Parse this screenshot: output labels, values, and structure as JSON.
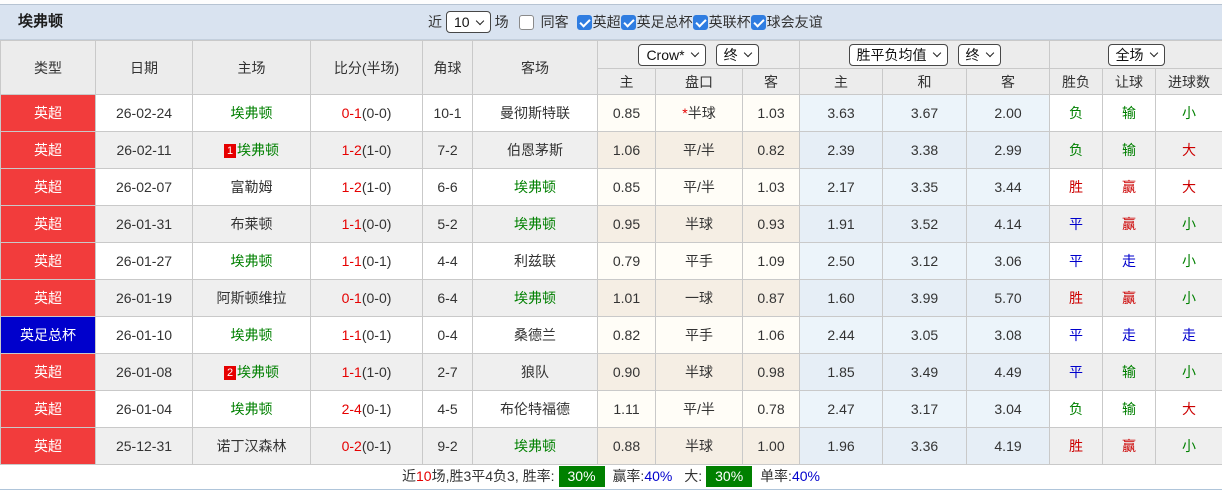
{
  "colors": {
    "league_red": "#f23c3c",
    "league_blue": "#0000cc",
    "focus_team_green": "#008000",
    "score_red": "#e60000",
    "result_red": "#cc0000",
    "result_green": "#008000",
    "result_blue": "#0000cc",
    "rate_badge_green": "#008000",
    "topbar_bg": "#d9e3f0"
  },
  "header": {
    "team": "埃弗顿",
    "recent_label": "近",
    "recent_count": "10",
    "games_label": "场",
    "filters": [
      {
        "label": "同客",
        "checked": false
      },
      {
        "label": "英超",
        "checked": true
      },
      {
        "label": "英足总杯",
        "checked": true
      },
      {
        "label": "英联杯",
        "checked": true
      },
      {
        "label": "球会友谊",
        "checked": true
      }
    ]
  },
  "table": {
    "left_headers": [
      "类型",
      "日期",
      "主场",
      "比分(半场)",
      "角球",
      "客场"
    ],
    "selects": {
      "company": "Crow*",
      "company_time": "终",
      "avg": "胜平负均值",
      "avg_time": "终",
      "scope": "全场"
    },
    "sub_headers": [
      "主",
      "盘口",
      "客",
      "主",
      "和",
      "客",
      "胜负",
      "让球",
      "进球数"
    ],
    "rows": [
      {
        "league": "英超",
        "league_bg": "#f23c3c",
        "date": "26-02-24",
        "home": "埃弗顿",
        "home_focus": true,
        "home_badge": "",
        "score": "0-1",
        "half": "(0-0)",
        "corner": "10-1",
        "away": "曼彻斯特联",
        "away_focus": false,
        "ah_home": "0.85",
        "star": "*",
        "handicap": "半球",
        "ah_away": "1.03",
        "avg_home": "3.63",
        "avg_draw": "3.67",
        "avg_away": "2.00",
        "result": "负",
        "result_c": "green",
        "give": "输",
        "give_c": "green",
        "goals": "小",
        "goals_c": "green"
      },
      {
        "league": "英超",
        "league_bg": "#f23c3c",
        "date": "26-02-11",
        "home": "埃弗顿",
        "home_focus": true,
        "home_badge": "1",
        "score": "1-2",
        "half": "(1-0)",
        "corner": "7-2",
        "away": "伯恩茅斯",
        "away_focus": false,
        "ah_home": "1.06",
        "star": "",
        "handicap": "平/半",
        "ah_away": "0.82",
        "avg_home": "2.39",
        "avg_draw": "3.38",
        "avg_away": "2.99",
        "result": "负",
        "result_c": "green",
        "give": "输",
        "give_c": "green",
        "goals": "大",
        "goals_c": "red"
      },
      {
        "league": "英超",
        "league_bg": "#f23c3c",
        "date": "26-02-07",
        "home": "富勒姆",
        "home_focus": false,
        "home_badge": "",
        "score": "1-2",
        "half": "(1-0)",
        "corner": "6-6",
        "away": "埃弗顿",
        "away_focus": true,
        "ah_home": "0.85",
        "star": "",
        "handicap": "平/半",
        "ah_away": "1.03",
        "avg_home": "2.17",
        "avg_draw": "3.35",
        "avg_away": "3.44",
        "result": "胜",
        "result_c": "red",
        "give": "赢",
        "give_c": "red",
        "goals": "大",
        "goals_c": "red"
      },
      {
        "league": "英超",
        "league_bg": "#f23c3c",
        "date": "26-01-31",
        "home": "布莱顿",
        "home_focus": false,
        "home_badge": "",
        "score": "1-1",
        "half": "(0-0)",
        "corner": "5-2",
        "away": "埃弗顿",
        "away_focus": true,
        "ah_home": "0.95",
        "star": "",
        "handicap": "半球",
        "ah_away": "0.93",
        "avg_home": "1.91",
        "avg_draw": "3.52",
        "avg_away": "4.14",
        "result": "平",
        "result_c": "blue",
        "give": "赢",
        "give_c": "red",
        "goals": "小",
        "goals_c": "green"
      },
      {
        "league": "英超",
        "league_bg": "#f23c3c",
        "date": "26-01-27",
        "home": "埃弗顿",
        "home_focus": true,
        "home_badge": "",
        "score": "1-1",
        "half": "(0-1)",
        "corner": "4-4",
        "away": "利兹联",
        "away_focus": false,
        "ah_home": "0.79",
        "star": "",
        "handicap": "平手",
        "ah_away": "1.09",
        "avg_home": "2.50",
        "avg_draw": "3.12",
        "avg_away": "3.06",
        "result": "平",
        "result_c": "blue",
        "give": "走",
        "give_c": "blue",
        "goals": "小",
        "goals_c": "green"
      },
      {
        "league": "英超",
        "league_bg": "#f23c3c",
        "date": "26-01-19",
        "home": "阿斯顿维拉",
        "home_focus": false,
        "home_badge": "",
        "score": "0-1",
        "half": "(0-0)",
        "corner": "6-4",
        "away": "埃弗顿",
        "away_focus": true,
        "ah_home": "1.01",
        "star": "",
        "handicap": "一球",
        "ah_away": "0.87",
        "avg_home": "1.60",
        "avg_draw": "3.99",
        "avg_away": "5.70",
        "result": "胜",
        "result_c": "red",
        "give": "赢",
        "give_c": "red",
        "goals": "小",
        "goals_c": "green"
      },
      {
        "league": "英足总杯",
        "league_bg": "#0000cc",
        "date": "26-01-10",
        "home": "埃弗顿",
        "home_focus": true,
        "home_badge": "",
        "score": "1-1",
        "half": "(0-1)",
        "corner": "0-4",
        "away": "桑德兰",
        "away_focus": false,
        "ah_home": "0.82",
        "star": "",
        "handicap": "平手",
        "ah_away": "1.06",
        "avg_home": "2.44",
        "avg_draw": "3.05",
        "avg_away": "3.08",
        "result": "平",
        "result_c": "blue",
        "give": "走",
        "give_c": "blue",
        "goals": "走",
        "goals_c": "blue"
      },
      {
        "league": "英超",
        "league_bg": "#f23c3c",
        "date": "26-01-08",
        "home": "埃弗顿",
        "home_focus": true,
        "home_badge": "2",
        "score": "1-1",
        "half": "(1-0)",
        "corner": "2-7",
        "away": "狼队",
        "away_focus": false,
        "ah_home": "0.90",
        "star": "",
        "handicap": "半球",
        "ah_away": "0.98",
        "avg_home": "1.85",
        "avg_draw": "3.49",
        "avg_away": "4.49",
        "result": "平",
        "result_c": "blue",
        "give": "输",
        "give_c": "green",
        "goals": "小",
        "goals_c": "green"
      },
      {
        "league": "英超",
        "league_bg": "#f23c3c",
        "date": "26-01-04",
        "home": "埃弗顿",
        "home_focus": true,
        "home_badge": "",
        "score": "2-4",
        "half": "(0-1)",
        "corner": "4-5",
        "away": "布伦特福德",
        "away_focus": false,
        "ah_home": "1.11",
        "star": "",
        "handicap": "平/半",
        "ah_away": "0.78",
        "avg_home": "2.47",
        "avg_draw": "3.17",
        "avg_away": "3.04",
        "result": "负",
        "result_c": "green",
        "give": "输",
        "give_c": "green",
        "goals": "大",
        "goals_c": "red"
      },
      {
        "league": "英超",
        "league_bg": "#f23c3c",
        "date": "25-12-31",
        "home": "诺丁汉森林",
        "home_focus": false,
        "home_badge": "",
        "score": "0-2",
        "half": "(0-1)",
        "corner": "9-2",
        "away": "埃弗顿",
        "away_focus": true,
        "ah_home": "0.88",
        "star": "",
        "handicap": "半球",
        "ah_away": "1.00",
        "avg_home": "1.96",
        "avg_draw": "3.36",
        "avg_away": "4.19",
        "result": "胜",
        "result_c": "red",
        "give": "赢",
        "give_c": "red",
        "goals": "小",
        "goals_c": "green"
      }
    ]
  },
  "footer": {
    "prefix": "近",
    "count": "10",
    "summary": "场,胜3平4负3, 胜率:",
    "win_rate": "30%",
    "win_label": "赢率:",
    "win_pct": "40%",
    "big_label": "大:",
    "big_rate": "30%",
    "single_label": "单率:",
    "single_pct": "40%"
  }
}
